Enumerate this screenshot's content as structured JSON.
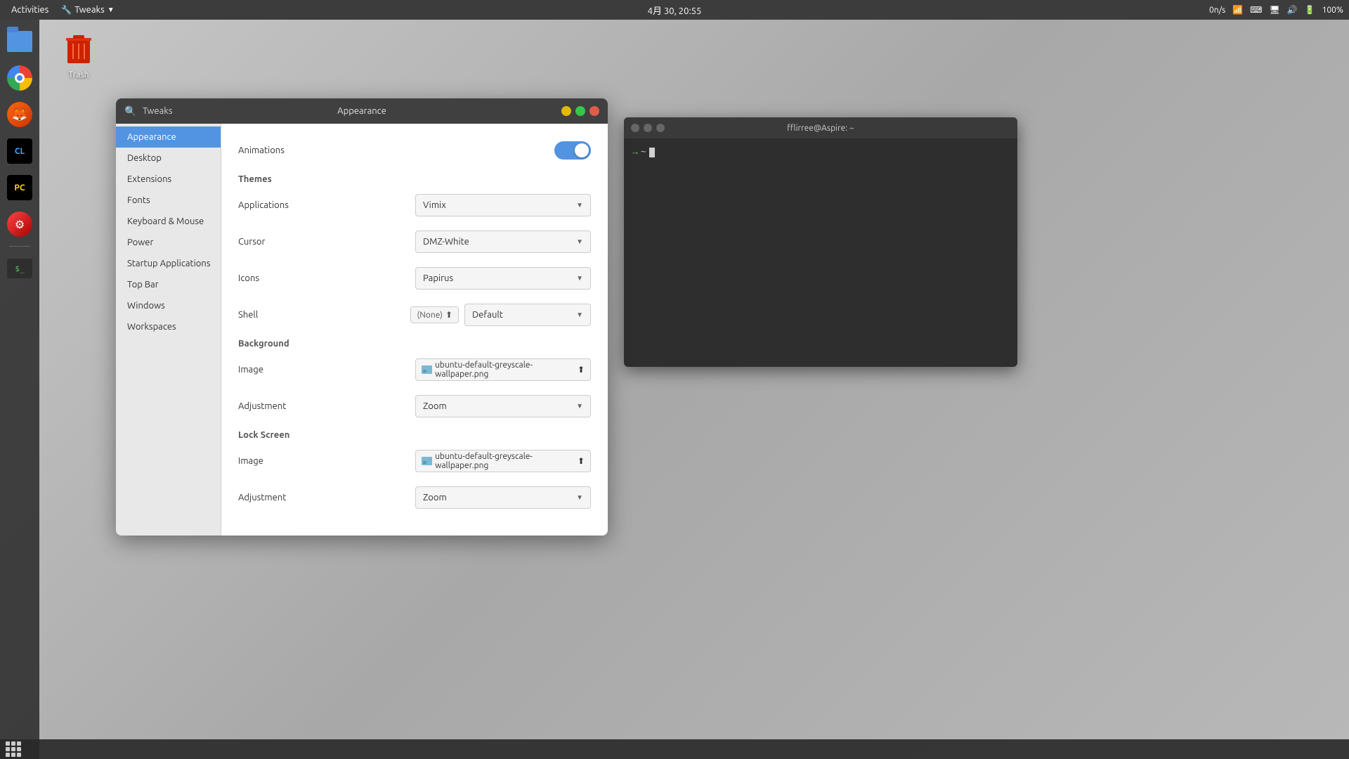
{
  "topbar": {
    "activities": "Activities",
    "tweaks_label": "Tweaks",
    "datetime": "4月 30, 20:55",
    "network_speed": "0n/s",
    "battery": "100%"
  },
  "desktop": {
    "trash_label": "Trash"
  },
  "tweaks_window": {
    "app_name": "Tweaks",
    "title": "Appearance",
    "sidebar_items": [
      {
        "id": "appearance",
        "label": "Appearance",
        "active": true
      },
      {
        "id": "desktop",
        "label": "Desktop",
        "active": false
      },
      {
        "id": "extensions",
        "label": "Extensions",
        "active": false
      },
      {
        "id": "fonts",
        "label": "Fonts",
        "active": false
      },
      {
        "id": "keyboard_mouse",
        "label": "Keyboard & Mouse",
        "active": false
      },
      {
        "id": "power",
        "label": "Power",
        "active": false
      },
      {
        "id": "startup_applications",
        "label": "Startup Applications",
        "active": false
      },
      {
        "id": "top_bar",
        "label": "Top Bar",
        "active": false
      },
      {
        "id": "windows",
        "label": "Windows",
        "active": false
      },
      {
        "id": "workspaces",
        "label": "Workspaces",
        "active": false
      }
    ],
    "content": {
      "animations_label": "Animations",
      "animations_on": true,
      "sections": {
        "themes": {
          "title": "Themes",
          "applications_label": "Applications",
          "applications_value": "Vimix",
          "cursor_label": "Cursor",
          "cursor_value": "DMZ-White",
          "icons_label": "Icons",
          "icons_value": "Papirus",
          "shell_label": "Shell",
          "shell_badge": "(None)",
          "shell_value": "Default"
        },
        "background": {
          "title": "Background",
          "image_label": "Image",
          "image_value": "ubuntu-default-greyscale-wallpaper.png",
          "adjustment_label": "Adjustment",
          "adjustment_value": "Zoom"
        },
        "lock_screen": {
          "title": "Lock Screen",
          "image_label": "Image",
          "image_value": "ubuntu-default-greyscale-wallpaper.png",
          "adjustment_label": "Adjustment",
          "adjustment_value": "Zoom"
        }
      }
    }
  },
  "terminal_window": {
    "title": "fflirree@Aspire: ~",
    "prompt": "→  ~ "
  }
}
